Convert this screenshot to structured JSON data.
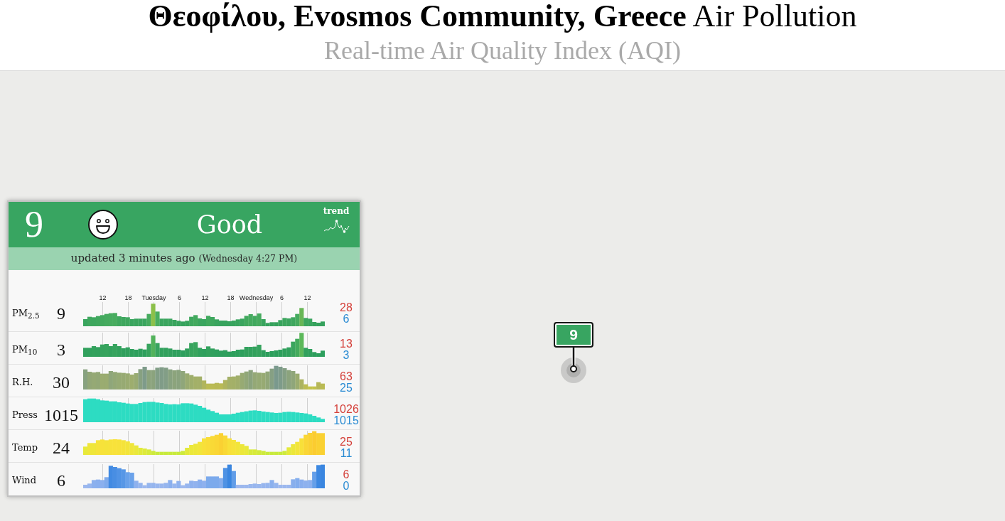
{
  "header": {
    "title": "**Θεοφίλου, Evosmos Community, Greece** Air Pollution",
    "subtitle": "Real-time Air Quality Index (AQI)"
  },
  "map": {
    "marker": {
      "value": "9"
    }
  },
  "aqi_panel": {
    "value": "9",
    "category": "Good",
    "trend_label": "trend",
    "updated": "updated 3 minutes ago",
    "updated_time": "(Wednesday 4:27 PM)",
    "timeline_ticks": [
      "12",
      "18",
      "Tuesday",
      "6",
      "12",
      "18",
      "Wednesday",
      "6",
      "12"
    ],
    "rows": [
      {
        "kind": "pm25",
        "label": "PM$_{2.5}$",
        "value": "9",
        "max": "28",
        "min": "6"
      },
      {
        "kind": "pm10",
        "label": "PM$_{10}$",
        "value": "3",
        "max": "13",
        "min": "3"
      },
      {
        "kind": "humidity",
        "label": "R.H.",
        "value": "30",
        "max": "63",
        "min": "25"
      },
      {
        "kind": "pressure",
        "label": "Press",
        "value": "1015",
        "max": "1026",
        "min": "1015"
      },
      {
        "kind": "temperature",
        "label": "Temp",
        "value": "24",
        "max": "25",
        "min": "11"
      },
      {
        "kind": "wind",
        "label": "Wind",
        "value": "6",
        "max": "6",
        "min": "0"
      }
    ]
  }
}
